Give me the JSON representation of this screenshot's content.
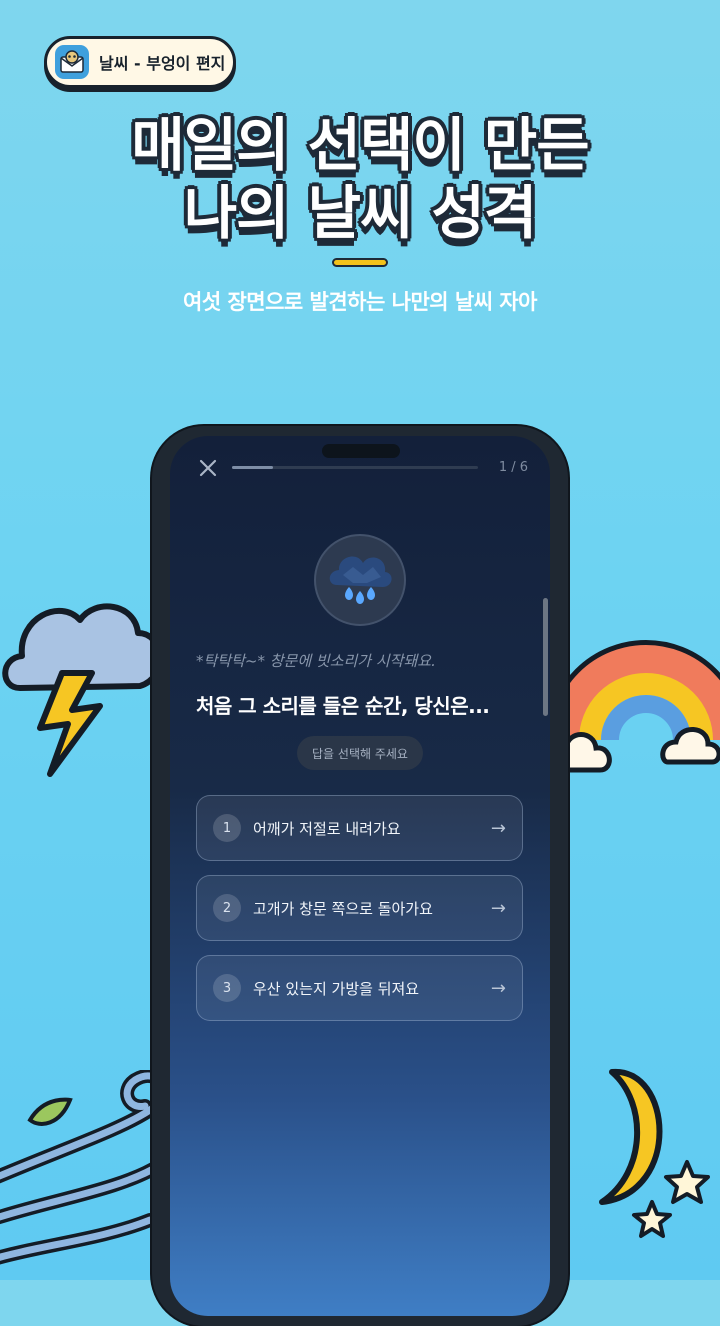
{
  "badge": {
    "text": "날씨 - 부엉이 편지",
    "icon": "owl-envelope-icon"
  },
  "headline": {
    "line1": "매일의 선택이 만든",
    "line2": "나의 날씨 성격"
  },
  "subtitle": "여섯 장면으로 발견하는 나만의 날씨 자아",
  "quiz": {
    "progress_text": "1 / 6",
    "progress_fraction": 0.1667,
    "scene_icon": "rain-cloud-icon",
    "scene_text": "*탁탁탁~* 창문에 빗소리가 시작돼요.",
    "question": "처음 그 소리를 들은 순간, 당신은...",
    "hint": "답을 선택해 주세요",
    "options": [
      {
        "num": "1",
        "label": "어깨가 저절로 내려가요"
      },
      {
        "num": "2",
        "label": "고개가 창문 쪽으로 돌아가요"
      },
      {
        "num": "3",
        "label": "우산 있는지 가방을 뒤져요"
      }
    ]
  },
  "colors": {
    "background": "#6dd3f2",
    "accent": "#f3c21a",
    "outline": "#1e2a38"
  }
}
